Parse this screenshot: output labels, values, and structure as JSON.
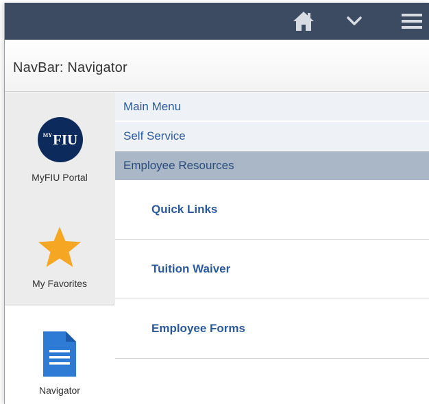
{
  "topbar": {
    "icons": [
      "home-icon",
      "chevron-down-icon",
      "menu-icon"
    ],
    "background": "#3d4b62"
  },
  "header": {
    "title": "NavBar: Navigator"
  },
  "rail": {
    "items": [
      {
        "label": "MyFIU Portal",
        "icon": "myfiu-logo-icon",
        "badge_text": "FIU",
        "badge_superscript": "MY"
      },
      {
        "label": "My Favorites",
        "icon": "star-icon"
      },
      {
        "label": "Navigator",
        "icon": "document-icon",
        "selected": true
      }
    ]
  },
  "breadcrumbs": [
    "Main Menu",
    "Self Service",
    "Employee Resources"
  ],
  "menu_items": [
    "Quick Links",
    "Tuition Waiver",
    "Employee Forms"
  ],
  "colors": {
    "link": "#2b5a9a",
    "active_crumb": "#a9b7c6",
    "star": "#f5a623",
    "document": "#2e7bd6"
  }
}
